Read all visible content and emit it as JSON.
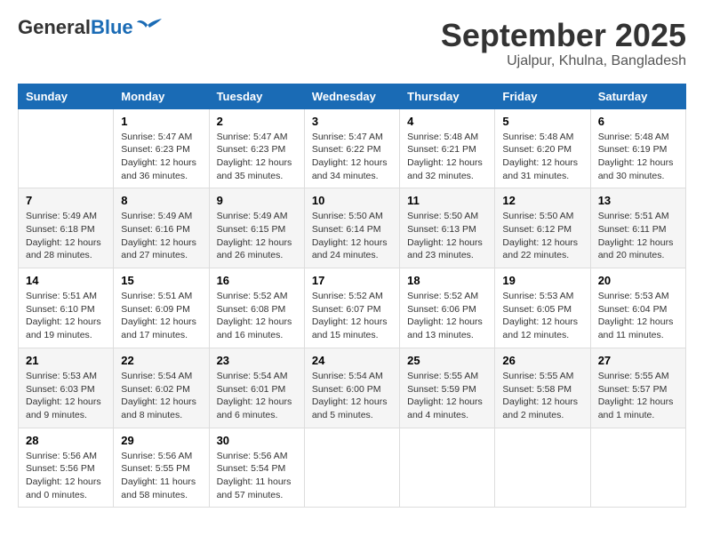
{
  "header": {
    "logo_general": "General",
    "logo_blue": "Blue",
    "month": "September 2025",
    "location": "Ujalpur, Khulna, Bangladesh"
  },
  "days_of_week": [
    "Sunday",
    "Monday",
    "Tuesday",
    "Wednesday",
    "Thursday",
    "Friday",
    "Saturday"
  ],
  "weeks": [
    [
      {
        "day": "",
        "info": ""
      },
      {
        "day": "1",
        "info": "Sunrise: 5:47 AM\nSunset: 6:23 PM\nDaylight: 12 hours\nand 36 minutes."
      },
      {
        "day": "2",
        "info": "Sunrise: 5:47 AM\nSunset: 6:23 PM\nDaylight: 12 hours\nand 35 minutes."
      },
      {
        "day": "3",
        "info": "Sunrise: 5:47 AM\nSunset: 6:22 PM\nDaylight: 12 hours\nand 34 minutes."
      },
      {
        "day": "4",
        "info": "Sunrise: 5:48 AM\nSunset: 6:21 PM\nDaylight: 12 hours\nand 32 minutes."
      },
      {
        "day": "5",
        "info": "Sunrise: 5:48 AM\nSunset: 6:20 PM\nDaylight: 12 hours\nand 31 minutes."
      },
      {
        "day": "6",
        "info": "Sunrise: 5:48 AM\nSunset: 6:19 PM\nDaylight: 12 hours\nand 30 minutes."
      }
    ],
    [
      {
        "day": "7",
        "info": "Sunrise: 5:49 AM\nSunset: 6:18 PM\nDaylight: 12 hours\nand 28 minutes."
      },
      {
        "day": "8",
        "info": "Sunrise: 5:49 AM\nSunset: 6:16 PM\nDaylight: 12 hours\nand 27 minutes."
      },
      {
        "day": "9",
        "info": "Sunrise: 5:49 AM\nSunset: 6:15 PM\nDaylight: 12 hours\nand 26 minutes."
      },
      {
        "day": "10",
        "info": "Sunrise: 5:50 AM\nSunset: 6:14 PM\nDaylight: 12 hours\nand 24 minutes."
      },
      {
        "day": "11",
        "info": "Sunrise: 5:50 AM\nSunset: 6:13 PM\nDaylight: 12 hours\nand 23 minutes."
      },
      {
        "day": "12",
        "info": "Sunrise: 5:50 AM\nSunset: 6:12 PM\nDaylight: 12 hours\nand 22 minutes."
      },
      {
        "day": "13",
        "info": "Sunrise: 5:51 AM\nSunset: 6:11 PM\nDaylight: 12 hours\nand 20 minutes."
      }
    ],
    [
      {
        "day": "14",
        "info": "Sunrise: 5:51 AM\nSunset: 6:10 PM\nDaylight: 12 hours\nand 19 minutes."
      },
      {
        "day": "15",
        "info": "Sunrise: 5:51 AM\nSunset: 6:09 PM\nDaylight: 12 hours\nand 17 minutes."
      },
      {
        "day": "16",
        "info": "Sunrise: 5:52 AM\nSunset: 6:08 PM\nDaylight: 12 hours\nand 16 minutes."
      },
      {
        "day": "17",
        "info": "Sunrise: 5:52 AM\nSunset: 6:07 PM\nDaylight: 12 hours\nand 15 minutes."
      },
      {
        "day": "18",
        "info": "Sunrise: 5:52 AM\nSunset: 6:06 PM\nDaylight: 12 hours\nand 13 minutes."
      },
      {
        "day": "19",
        "info": "Sunrise: 5:53 AM\nSunset: 6:05 PM\nDaylight: 12 hours\nand 12 minutes."
      },
      {
        "day": "20",
        "info": "Sunrise: 5:53 AM\nSunset: 6:04 PM\nDaylight: 12 hours\nand 11 minutes."
      }
    ],
    [
      {
        "day": "21",
        "info": "Sunrise: 5:53 AM\nSunset: 6:03 PM\nDaylight: 12 hours\nand 9 minutes."
      },
      {
        "day": "22",
        "info": "Sunrise: 5:54 AM\nSunset: 6:02 PM\nDaylight: 12 hours\nand 8 minutes."
      },
      {
        "day": "23",
        "info": "Sunrise: 5:54 AM\nSunset: 6:01 PM\nDaylight: 12 hours\nand 6 minutes."
      },
      {
        "day": "24",
        "info": "Sunrise: 5:54 AM\nSunset: 6:00 PM\nDaylight: 12 hours\nand 5 minutes."
      },
      {
        "day": "25",
        "info": "Sunrise: 5:55 AM\nSunset: 5:59 PM\nDaylight: 12 hours\nand 4 minutes."
      },
      {
        "day": "26",
        "info": "Sunrise: 5:55 AM\nSunset: 5:58 PM\nDaylight: 12 hours\nand 2 minutes."
      },
      {
        "day": "27",
        "info": "Sunrise: 5:55 AM\nSunset: 5:57 PM\nDaylight: 12 hours\nand 1 minute."
      }
    ],
    [
      {
        "day": "28",
        "info": "Sunrise: 5:56 AM\nSunset: 5:56 PM\nDaylight: 12 hours\nand 0 minutes."
      },
      {
        "day": "29",
        "info": "Sunrise: 5:56 AM\nSunset: 5:55 PM\nDaylight: 11 hours\nand 58 minutes."
      },
      {
        "day": "30",
        "info": "Sunrise: 5:56 AM\nSunset: 5:54 PM\nDaylight: 11 hours\nand 57 minutes."
      },
      {
        "day": "",
        "info": ""
      },
      {
        "day": "",
        "info": ""
      },
      {
        "day": "",
        "info": ""
      },
      {
        "day": "",
        "info": ""
      }
    ]
  ]
}
